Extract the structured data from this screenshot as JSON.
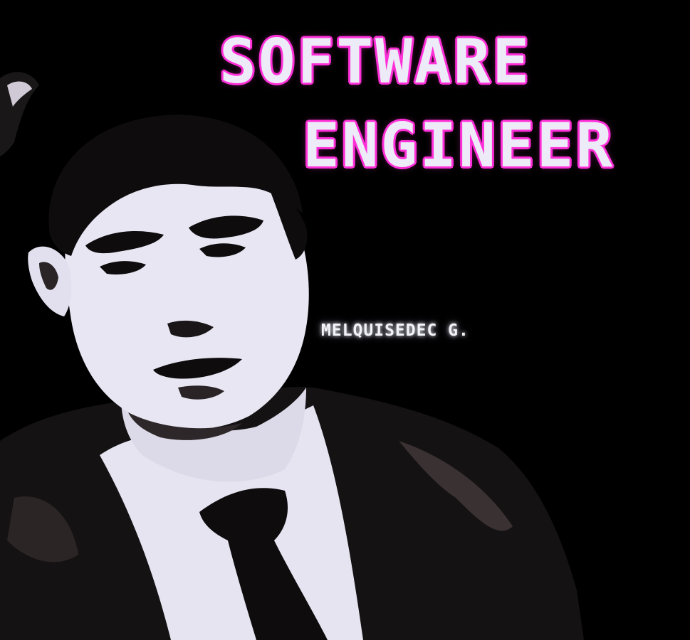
{
  "title": {
    "line1": "SOFTWARE",
    "line2": "ENGINEER"
  },
  "author": {
    "name": "MELQUISEDEC G."
  },
  "colors": {
    "background": "#000000",
    "title_fill": "#ecebf7",
    "title_outline": "#ff2fd8",
    "portrait_light": "#e8e6f3",
    "portrait_dark": "#0d0b0c"
  },
  "artwork": {
    "subject": "posterized-portrait-of-man-in-suit-and-tie"
  }
}
